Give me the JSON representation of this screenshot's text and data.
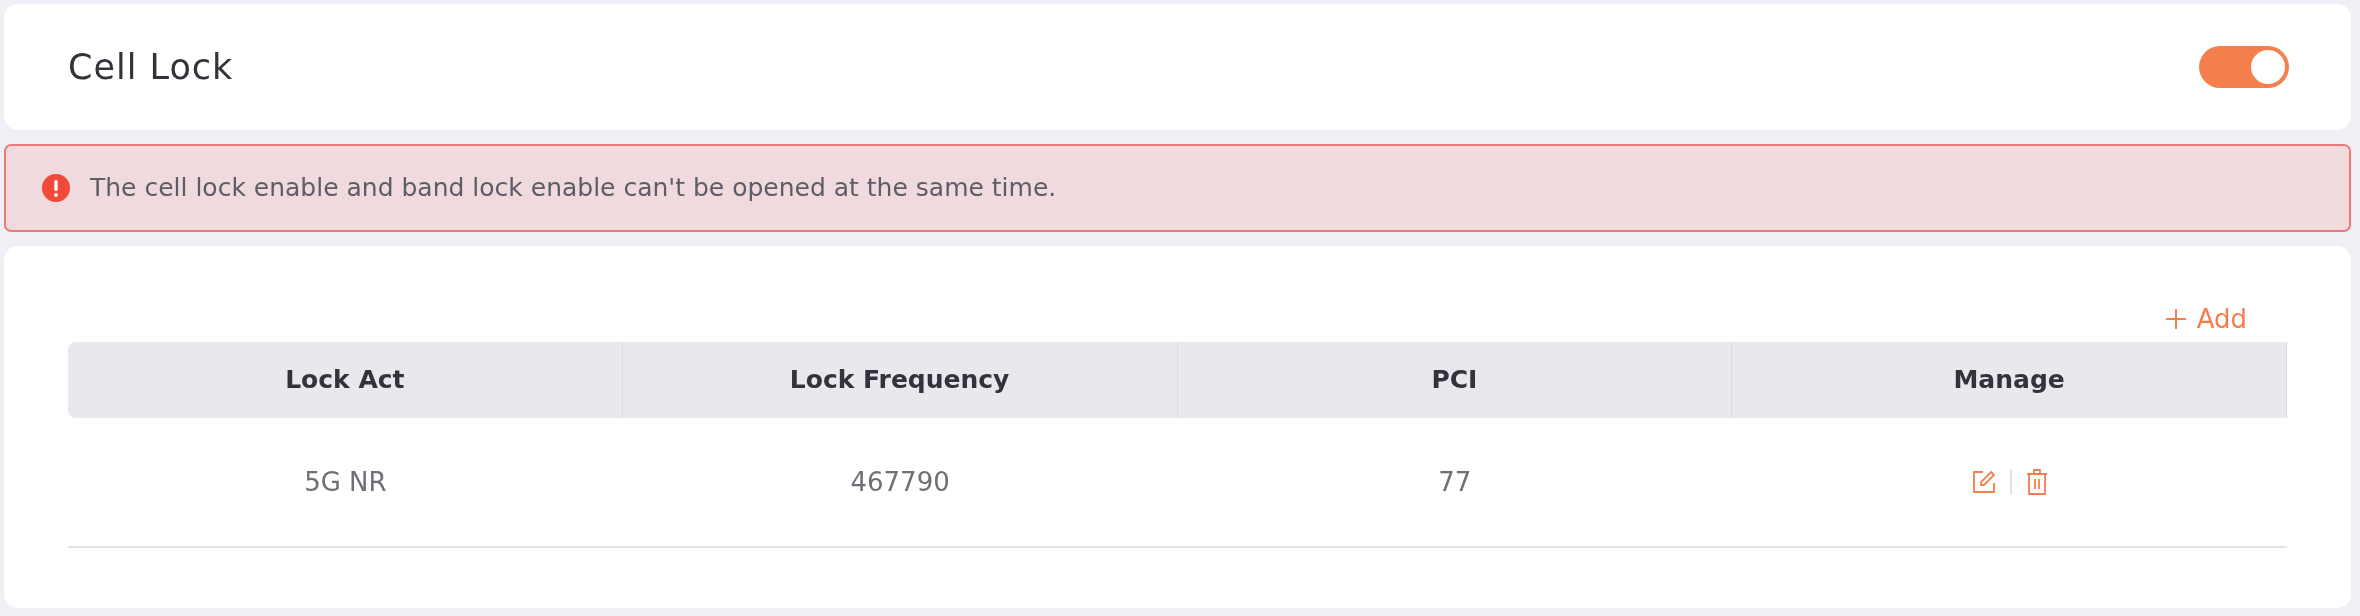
{
  "header": {
    "title": "Cell Lock",
    "toggle": {
      "on": true
    }
  },
  "alert": {
    "message": "The cell lock enable and band lock enable can't be opened at the same time."
  },
  "add_button": {
    "label": "Add"
  },
  "table": {
    "columns": [
      "Lock Act",
      "Lock Frequency",
      "PCI",
      "Manage"
    ],
    "rows": [
      {
        "cells": [
          "5G NR",
          "467790",
          "77"
        ]
      }
    ]
  }
}
